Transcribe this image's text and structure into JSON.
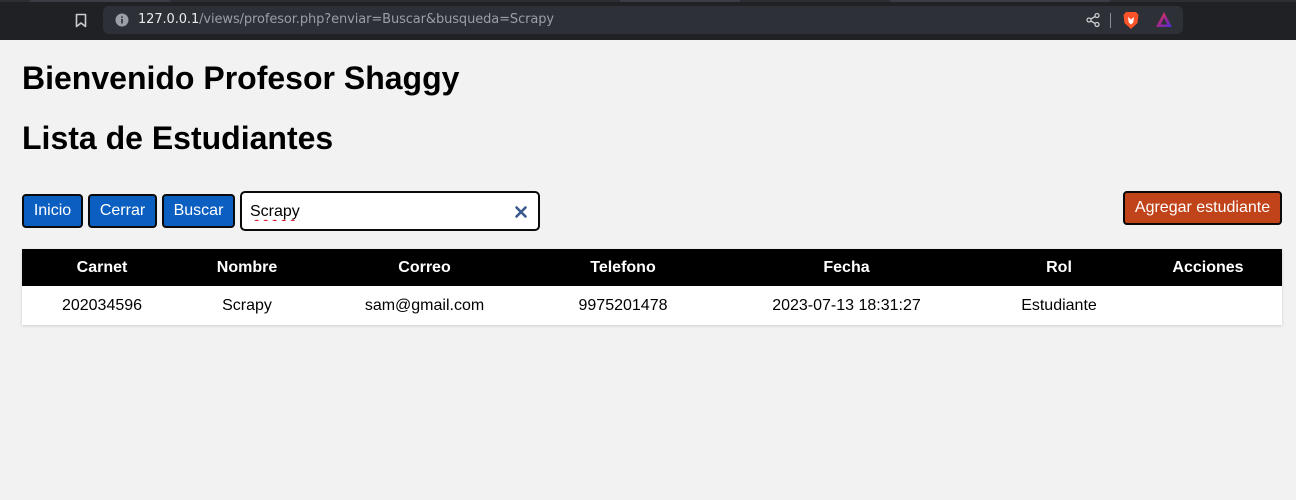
{
  "browser": {
    "url_host": "127.0.0.1",
    "url_path": "/views/profesor.php?enviar=Buscar&busqueda=Scrapy",
    "icons": [
      "bookmark-icon",
      "site-info-icon",
      "share-icon",
      "brave-shields-icon",
      "brave-rewards-icon"
    ]
  },
  "page": {
    "welcome_title": "Bienvenido Profesor Shaggy",
    "list_title": "Lista de Estudiantes"
  },
  "toolbar": {
    "inicio_label": "Inicio",
    "cerrar_label": "Cerrar",
    "buscar_label": "Buscar",
    "search_value": "Scrapy",
    "add_label": "Agregar estudiante"
  },
  "table": {
    "headers": [
      "Carnet",
      "Nombre",
      "Correo",
      "Telefono",
      "Fecha",
      "Rol",
      "Acciones"
    ],
    "rows": [
      {
        "carnet": "202034596",
        "nombre": "Scrapy",
        "correo": "sam@gmail.com",
        "telefono": "9975201478",
        "fecha": "2023-07-13 18:31:27",
        "rol": "Estudiante",
        "acciones": ""
      }
    ]
  },
  "colors": {
    "primary_button": "#0b5fc1",
    "add_button": "#c0431a",
    "table_header_bg": "#000000",
    "page_bg": "#f2f2f2"
  }
}
